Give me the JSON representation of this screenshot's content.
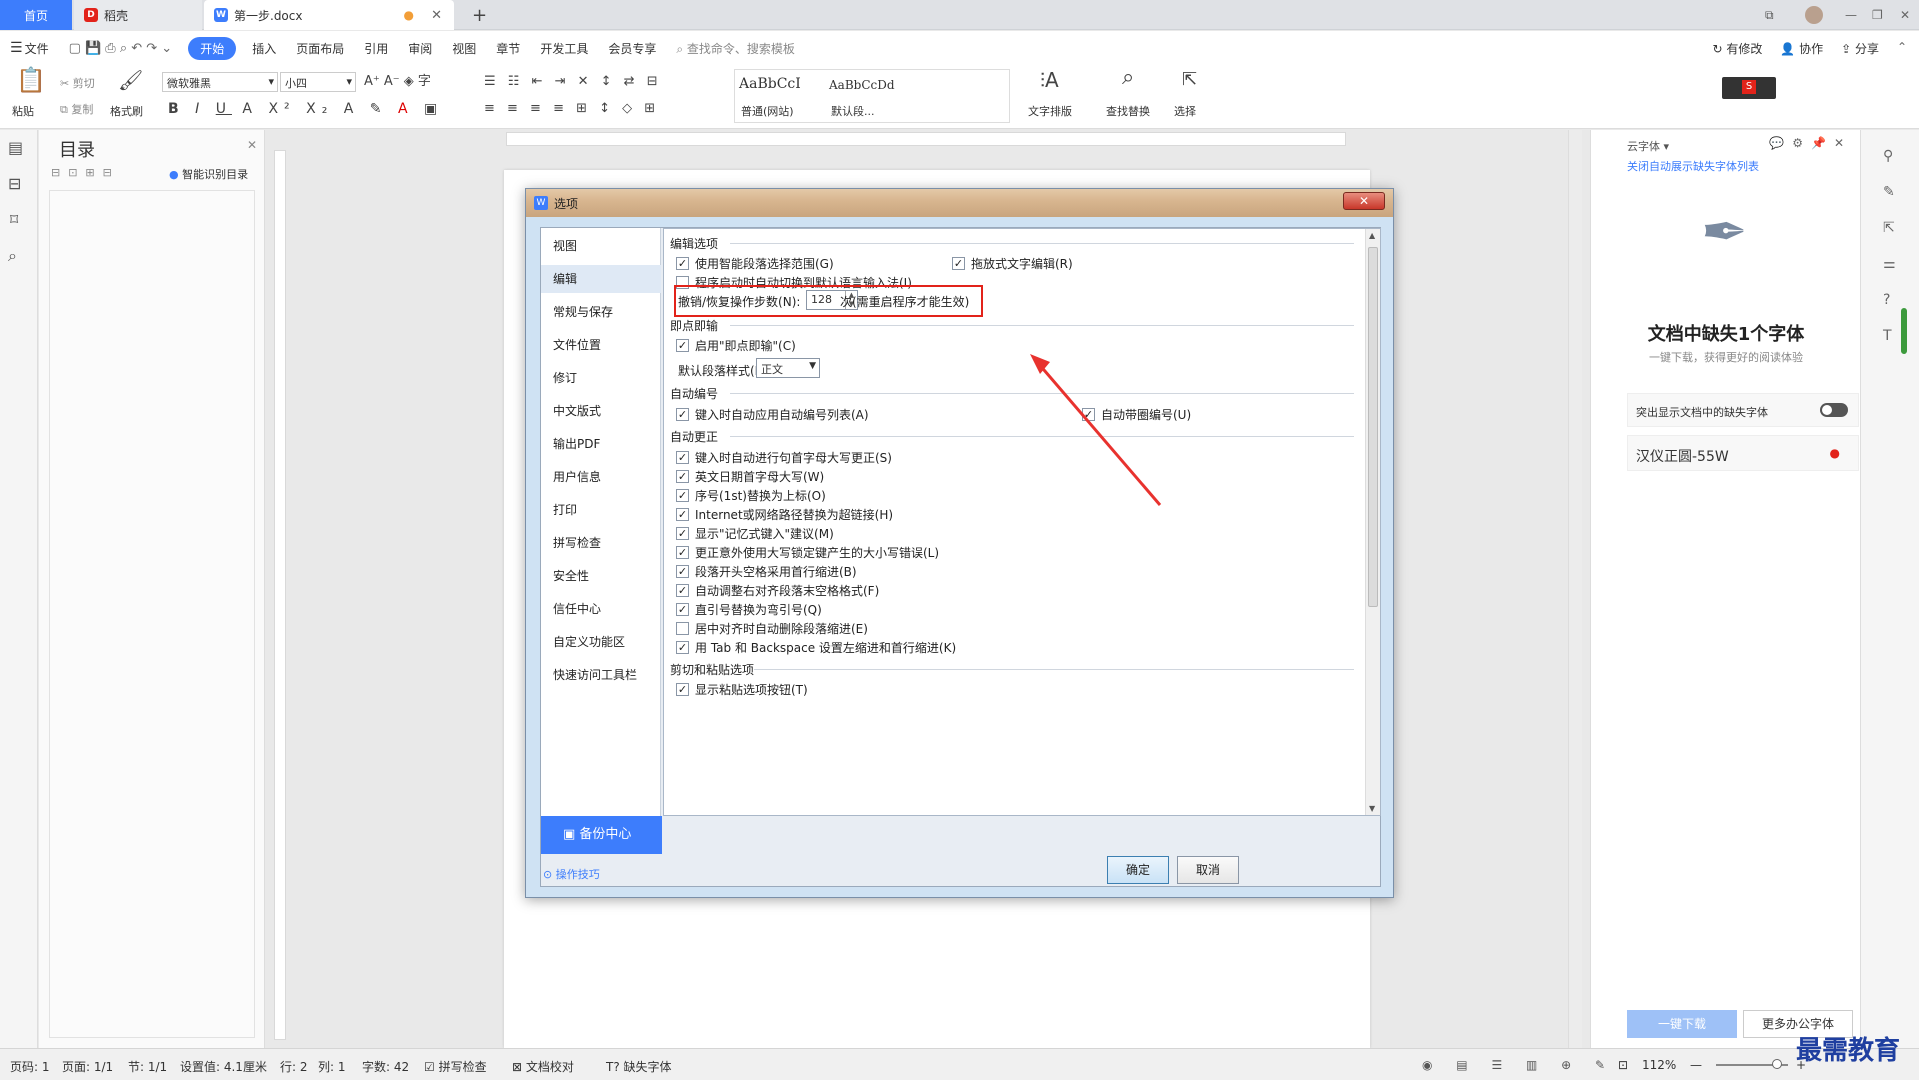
{
  "tabs": {
    "home": "首页",
    "daoke": "稻壳",
    "doc": "第一步.docx"
  },
  "menu": {
    "file": "文件",
    "items": [
      "开始",
      "插入",
      "页面布局",
      "引用",
      "审阅",
      "视图",
      "章节",
      "开发工具",
      "会员专享"
    ],
    "search": "查找命令、搜索模板",
    "right": [
      "有修改",
      "协作",
      "分享"
    ]
  },
  "ribbon": {
    "paste": "粘贴",
    "cut": "剪切",
    "copy": "复制",
    "format_painter": "格式刷",
    "font": "微软雅黑",
    "size": "小四",
    "styles": [
      {
        "preview": "AaBbCcI",
        "name": "普通(网站)"
      },
      {
        "preview": "AaBbCcDd",
        "name": "默认段..."
      }
    ],
    "text_layout": "文字排版",
    "find_replace": "查找替换",
    "select": "选择"
  },
  "nav": {
    "title": "目录",
    "smart": "智能识别目录"
  },
  "dialog": {
    "title": "选项",
    "nav": [
      "视图",
      "编辑",
      "常规与保存",
      "文件位置",
      "修订",
      "中文版式",
      "输出PDF",
      "用户信息",
      "打印",
      "拼写检查",
      "安全性",
      "信任中心",
      "自定义功能区",
      "快速访问工具栏"
    ],
    "backup": "备份中心",
    "tips": "操作技巧",
    "ok": "确定",
    "cancel": "取消",
    "sections": {
      "edit": "编辑选项",
      "instant": "即点即输",
      "autonum": "自动编号",
      "autocorrect": "自动更正",
      "cutpaste": "剪切和粘贴选项"
    },
    "edit_opts": {
      "smart_para": "使用智能段落选择范围(G)",
      "drag": "拖放式文字编辑(R)",
      "ime": "程序启动时自动切换到默认语言输入法(I)",
      "undo_label": "撤销/恢复操作步数(N):",
      "undo_value": "128",
      "undo_note": "次(需重启程序才能生效)"
    },
    "instant_opts": {
      "enable": "启用\"即点即输\"(C)",
      "style_label": "默认段落样式(P):",
      "style_value": "正文"
    },
    "autonum_opts": {
      "list": "键入时自动应用自动编号列表(A)",
      "circle": "自动带圈编号(U)"
    },
    "autocorrect_opts": [
      "键入时自动进行句首字母大写更正(S)",
      "英文日期首字母大写(W)",
      "序号(1st)替换为上标(O)",
      "Internet或网络路径替换为超链接(H)",
      "显示\"记忆式键入\"建议(M)",
      "更正意外使用大写锁定键产生的大小写错误(L)",
      "段落开头空格采用首行缩进(B)",
      "自动调整右对齐段落末空格格式(F)",
      "直引号替换为弯引号(Q)",
      "居中对齐时自动删除段落缩进(E)",
      "用 Tab 和 Backspace 设置左缩进和首行缩进(K)"
    ],
    "autocorrect_checked": [
      true,
      true,
      true,
      true,
      true,
      true,
      true,
      true,
      true,
      false,
      true
    ],
    "cutpaste_opts": {
      "show_btn": "显示粘贴选项按钮(T)"
    }
  },
  "right_panel": {
    "header": "云字体",
    "link": "关闭自动展示缺失字体列表",
    "heading": "文档中缺失1个字体",
    "sub": "一键下载，获得更好的阅读体验",
    "toggle_label": "突出显示文档中的缺失字体",
    "font_item": "汉仪正圆-55W",
    "download": "一键下载",
    "more": "更多办公字体"
  },
  "status": {
    "page": "页码: 1",
    "pages": "页面: 1/1",
    "section": "节: 1/1",
    "setting": "设置值: 4.1厘米",
    "row": "行: 2",
    "col": "列: 1",
    "words": "字数: 42",
    "spell": "拼写检查",
    "proof": "文档校对",
    "missing": "缺失字体",
    "zoom": "112%"
  },
  "watermark": "最需教育",
  "colors": {
    "accent": "#3d7dfc",
    "highlight": "#e2231a",
    "arrow": "#e8322e"
  }
}
